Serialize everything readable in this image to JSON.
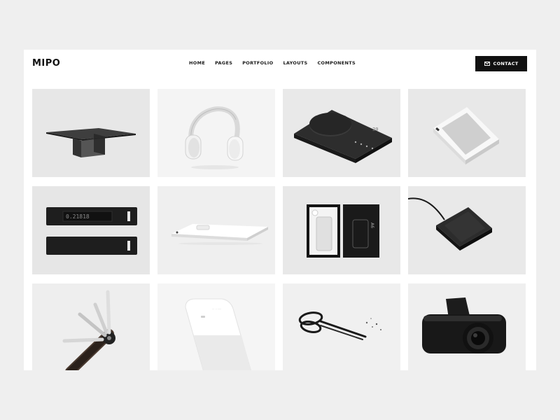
{
  "brand": {
    "logo": "MIPO"
  },
  "nav": {
    "items": [
      {
        "label": "HOME"
      },
      {
        "label": "PAGES"
      },
      {
        "label": "PORTFOLIO"
      },
      {
        "label": "LAYOUTS"
      },
      {
        "label": "COMPONENTS"
      }
    ]
  },
  "contact_button": {
    "label": "CONTACT",
    "icon": "envelope-icon"
  },
  "portfolio": {
    "items": [
      {
        "subject": "glass-table",
        "bg": "#e7e7e7"
      },
      {
        "subject": "headphones",
        "bg": "#f4f4f4"
      },
      {
        "subject": "black-scale",
        "bg": "#e9e9e9"
      },
      {
        "subject": "speaker",
        "bg": "#e8e8e8"
      },
      {
        "subject": "usb-keys",
        "bg": "#e6e6e6",
        "readout": "0.21818"
      },
      {
        "subject": "white-phone",
        "bg": "#efefef"
      },
      {
        "subject": "packaged-bottle",
        "bg": "#e8e8e8",
        "package_text": "A6"
      },
      {
        "subject": "wireless-charger",
        "bg": "#e9e9e9"
      },
      {
        "subject": "key-organizer",
        "bg": "#eeeeee"
      },
      {
        "subject": "white-device",
        "bg": "#f5f5f5"
      },
      {
        "subject": "scissors",
        "bg": "#f0f0f0"
      },
      {
        "subject": "dash-camera",
        "bg": "#efefef"
      }
    ]
  }
}
